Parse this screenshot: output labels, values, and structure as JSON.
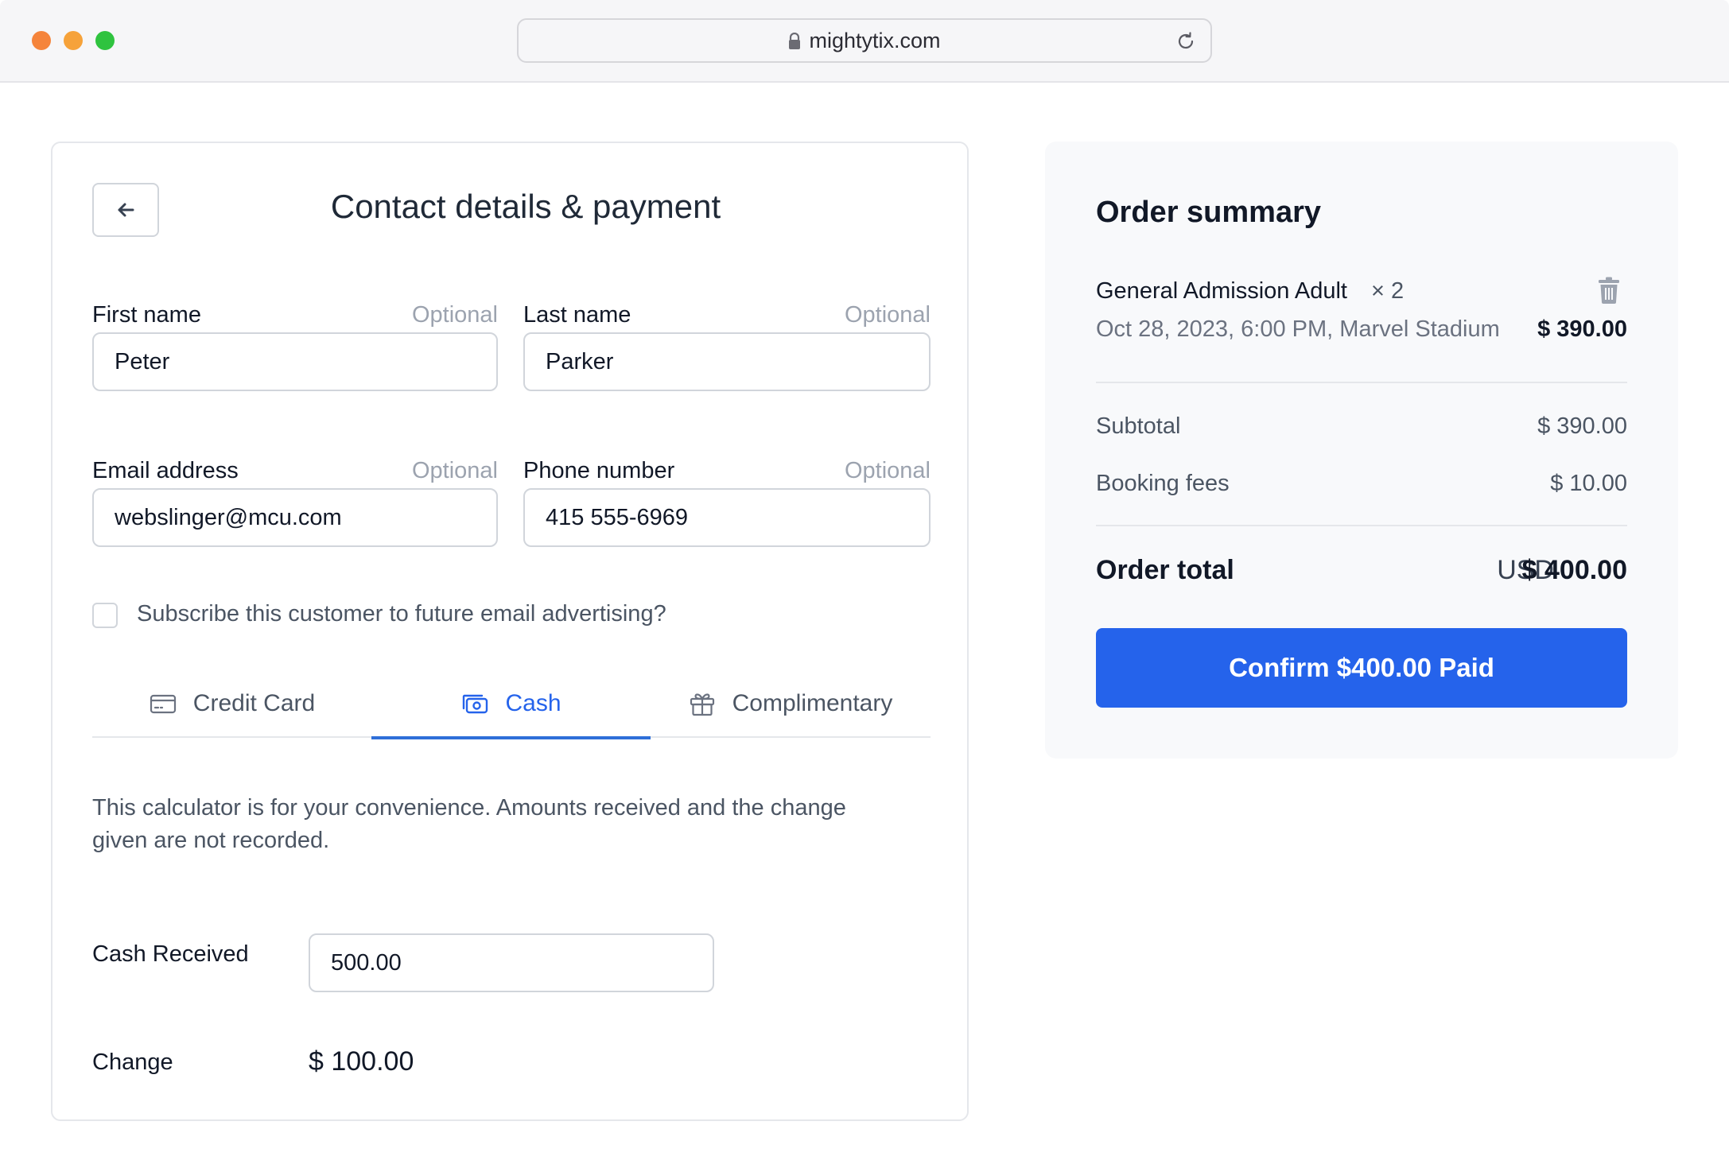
{
  "browser": {
    "url": "mightytix.com"
  },
  "form": {
    "title": "Contact details & payment",
    "first_name": {
      "label": "First name",
      "optional": "Optional",
      "value": "Peter"
    },
    "last_name": {
      "label": "Last name",
      "optional": "Optional",
      "value": "Parker"
    },
    "email": {
      "label": "Email address",
      "optional": "Optional",
      "value": "webslinger@mcu.com"
    },
    "phone": {
      "label": "Phone number",
      "optional": "Optional",
      "value": "415 555-6969"
    },
    "subscribe_label": "Subscribe this customer to future email advertising?",
    "tabs": [
      {
        "label": "Credit Card",
        "icon": "credit-card-icon"
      },
      {
        "label": "Cash",
        "icon": "cash-icon",
        "active": true
      },
      {
        "label": "Complimentary",
        "icon": "gift-icon"
      }
    ],
    "note": "This calculator is for your convenience. Amounts received and the change given are not recorded.",
    "cash_received": {
      "label": "Cash Received",
      "value": "500.00"
    },
    "change": {
      "label": "Change",
      "value": "$ 100.00"
    }
  },
  "summary": {
    "title": "Order summary",
    "item": {
      "name": "General Admission Adult",
      "qty": "× 2",
      "meta": "Oct 28, 2023, 6:00 PM, Marvel Stadium",
      "price": "$ 390.00"
    },
    "subtotal": {
      "label": "Subtotal",
      "value": "$ 390.00"
    },
    "fees": {
      "label": "Booking fees",
      "value": "$ 10.00"
    },
    "total": {
      "label": "Order total",
      "currency": "USD",
      "value": "$ 400.00"
    },
    "confirm_label": "Confirm $400.00 Paid"
  },
  "colors": {
    "accent": "#2563eb",
    "tab_underline": "#2f6fd8"
  }
}
